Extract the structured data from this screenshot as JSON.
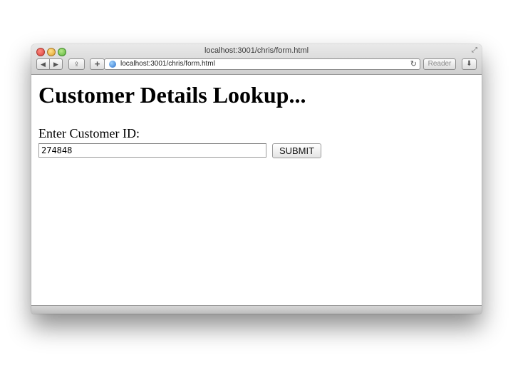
{
  "window": {
    "title": "localhost:3001/chris/form.html"
  },
  "toolbar": {
    "back_icon": "◀",
    "forward_icon": "▶",
    "share_icon": "⇪",
    "add_icon": "+",
    "url": "localhost:3001/chris/form.html",
    "reload_icon": "↻",
    "reader_label": "Reader",
    "download_icon": "⬇",
    "fullscreen_icon": "⤢"
  },
  "page": {
    "heading": "Customer Details Lookup...",
    "field_label": "Enter Customer ID:",
    "customer_id_value": "274848",
    "submit_label": "SUBMIT"
  }
}
